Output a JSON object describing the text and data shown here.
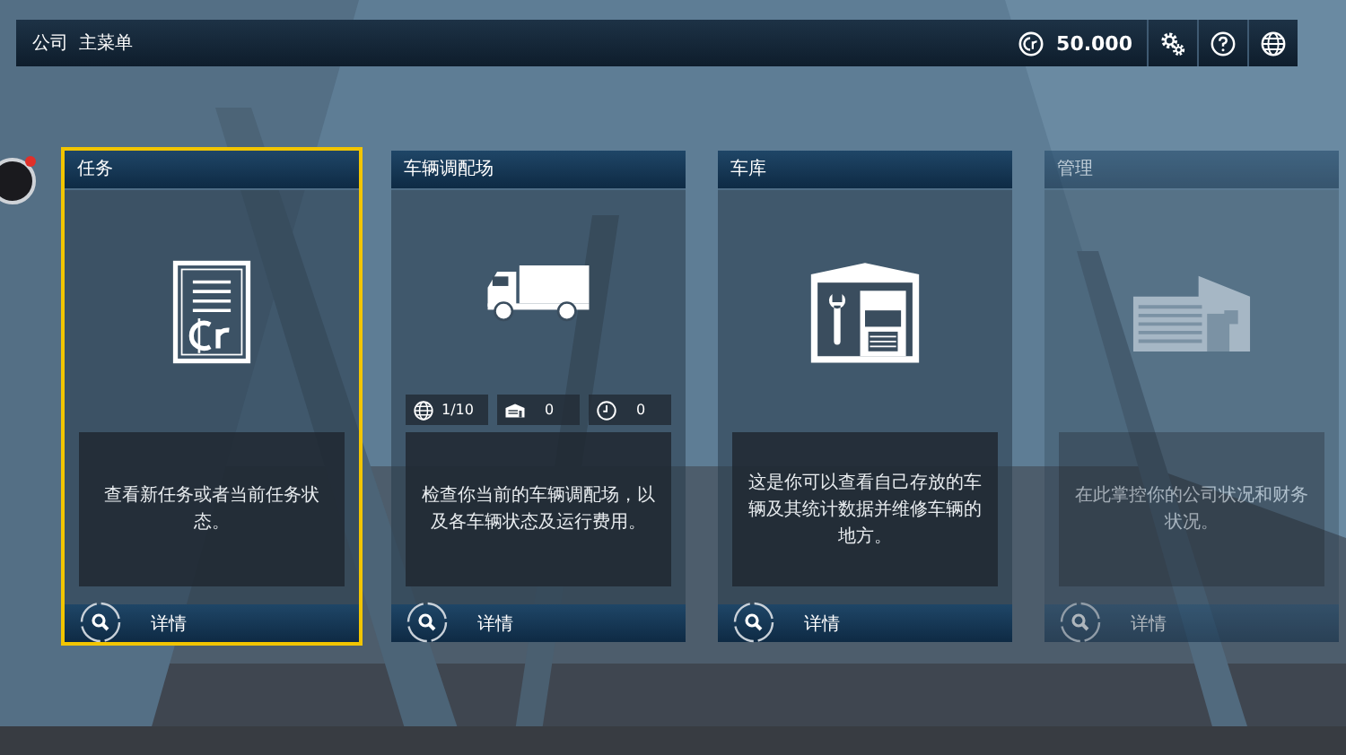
{
  "top_bar": {
    "breadcrumb": [
      "公司",
      "主菜单"
    ],
    "balance": "50.000"
  },
  "cards": [
    {
      "kind": "contracts",
      "title": "任务",
      "description": "查看新任务或者当前任务状态。",
      "button": "详情",
      "selected": true,
      "disabled": false
    },
    {
      "kind": "fleet",
      "title": "车辆调配场",
      "stats": [
        {
          "kind": "globe",
          "value": "1/10"
        },
        {
          "kind": "garage",
          "value": "0"
        },
        {
          "kind": "clock",
          "value": "0"
        }
      ],
      "description": "检查你当前的车辆调配场，以及各车辆状态及运行费用。",
      "button": "详情",
      "selected": false,
      "disabled": false
    },
    {
      "kind": "garage",
      "title": "车库",
      "description": "这是你可以查看自己存放的车辆及其统计数据并维修车辆的地方。",
      "button": "详情",
      "selected": false,
      "disabled": false
    },
    {
      "kind": "management",
      "title": "管理",
      "description": "在此掌控你的公司状况和财务状况。",
      "button": "详情",
      "selected": false,
      "disabled": true
    }
  ]
}
